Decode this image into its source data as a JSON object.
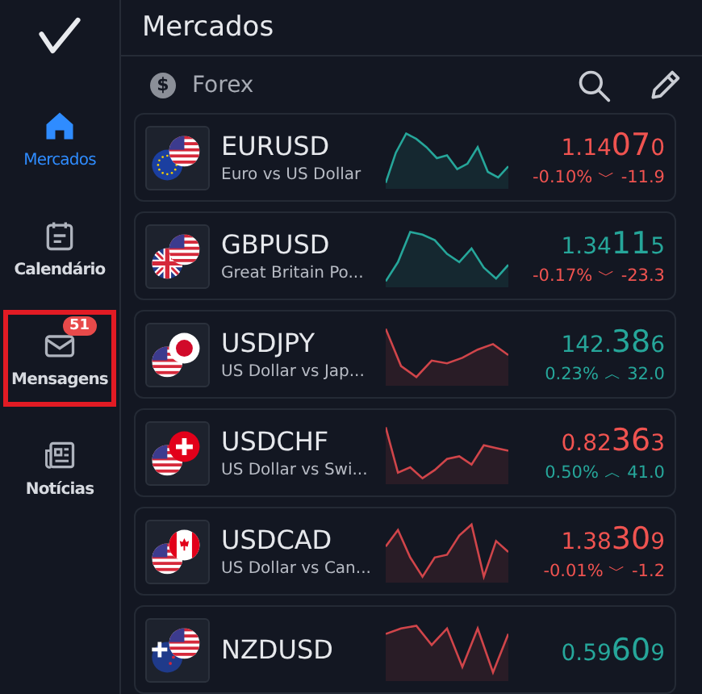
{
  "sidebar": {
    "items": [
      {
        "kind": "home",
        "label": "Mercados",
        "selected": true,
        "highlighted": false
      },
      {
        "kind": "calendar",
        "label": "Calendário",
        "selected": false,
        "highlighted": false
      },
      {
        "kind": "mail",
        "label": "Mensagens",
        "selected": false,
        "highlighted": true,
        "badge": "51"
      },
      {
        "kind": "news",
        "label": "Notícias",
        "selected": false,
        "highlighted": false
      }
    ]
  },
  "header": {
    "title": "Mercados"
  },
  "section": {
    "icon_glyph": "$",
    "title": "Forex"
  },
  "quotes": [
    {
      "symbol": "EURUSD",
      "description": "Euro vs US Dollar",
      "flags": [
        {
          "kind": "eu"
        },
        {
          "kind": "us"
        }
      ],
      "chart_rising": true,
      "price_head": "1.14",
      "price_big": "07",
      "price_tail": "0",
      "price_rising": false,
      "change": "-0.10% ﹀ -11.9",
      "change_rising": false
    },
    {
      "symbol": "GBPUSD",
      "description": "Great Britain Po...",
      "flags": [
        {
          "kind": "gb"
        },
        {
          "kind": "us"
        }
      ],
      "chart_rising": true,
      "price_head": "1.34",
      "price_big": "11",
      "price_tail": "5",
      "price_rising": true,
      "change": "-0.17% ﹀ -23.3",
      "change_rising": false
    },
    {
      "symbol": "USDJPY",
      "description": "US Dollar vs Jap...",
      "flags": [
        {
          "kind": "us"
        },
        {
          "kind": "jp"
        }
      ],
      "chart_rising": false,
      "price_head": "142.",
      "price_big": "38",
      "price_tail": "6",
      "price_rising": true,
      "change": "0.23% ︿ 32.0",
      "change_rising": true
    },
    {
      "symbol": "USDCHF",
      "description": "US Dollar vs Swi...",
      "flags": [
        {
          "kind": "us"
        },
        {
          "kind": "ch"
        }
      ],
      "chart_rising": false,
      "price_head": "0.82",
      "price_big": "36",
      "price_tail": "3",
      "price_rising": false,
      "change": "0.50% ︿ 41.0",
      "change_rising": true
    },
    {
      "symbol": "USDCAD",
      "description": "US Dollar vs Can...",
      "flags": [
        {
          "kind": "us"
        },
        {
          "kind": "ca"
        }
      ],
      "chart_rising": false,
      "price_head": "1.38",
      "price_big": "30",
      "price_tail": "9",
      "price_rising": false,
      "change": "-0.01% ﹀ -1.2",
      "change_rising": false
    },
    {
      "symbol": "NZDUSD",
      "flags": [
        {
          "kind": "nz"
        },
        {
          "kind": "us"
        }
      ],
      "chart_rising": false,
      "price_head": "0.59",
      "price_big": "60",
      "price_tail": "9",
      "price_rising": true
    }
  ]
}
